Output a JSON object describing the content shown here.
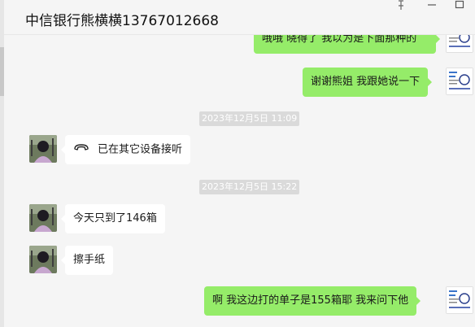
{
  "window": {
    "title": "中信银行熊横横13767012668",
    "controls": {
      "pin": "pin-icon",
      "minimize": "minimize-icon",
      "maximize": "maximize-icon"
    }
  },
  "colors": {
    "sent_bubble": "#95ec69",
    "received_bubble": "#ffffff",
    "background": "#f5f5f5"
  },
  "messages": [
    {
      "side": "out",
      "type": "text",
      "text": "哦哦 晓得了 我以为是下面那种的",
      "partially_visible": true
    },
    {
      "side": "out",
      "type": "text",
      "text": "谢谢熊姐 我跟她说一下"
    },
    {
      "type": "timestamp",
      "text": "2023年12月5日 11:09"
    },
    {
      "side": "in",
      "type": "call",
      "text": "已在其它设备接听",
      "icon": "phone-icon"
    },
    {
      "type": "timestamp",
      "text": "2023年12月5日 15:22"
    },
    {
      "side": "in",
      "type": "text",
      "text": "今天只到了146箱"
    },
    {
      "side": "in",
      "type": "text",
      "text": "擦手纸"
    },
    {
      "side": "out",
      "type": "text",
      "text": "啊  我这边打的单子是155箱耶  我来问下他"
    }
  ]
}
